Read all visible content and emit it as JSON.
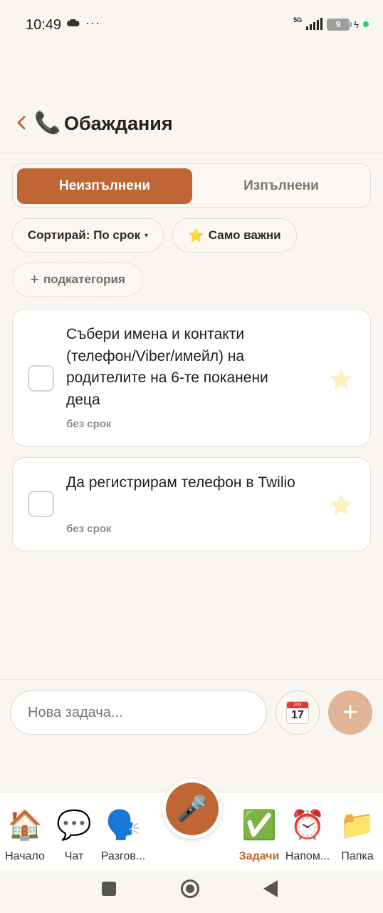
{
  "status_bar": {
    "time": "10:49",
    "dots": "···",
    "network": "5G",
    "battery": "9",
    "icons": [
      "cloud-icon",
      "signal-icon",
      "battery-icon",
      "charging-icon"
    ]
  },
  "header": {
    "back_icon": "chevron-left-icon",
    "emoji": "📞",
    "title": "Обаждания"
  },
  "tabs": [
    {
      "label": "Неизпълнени",
      "active": true
    },
    {
      "label": "Изпълнени",
      "active": false
    }
  ],
  "filters": {
    "sort_label": "Сортирай: По срок",
    "sort_caret": "▾",
    "important_star": "⭐",
    "important_label": "Само важни",
    "subcategory_plus": "+",
    "subcategory_label": "подкатегория"
  },
  "tasks": [
    {
      "text": "Събери имена и контакти (телефон/Viber/имейл) на родителите на 6-те поканени деца",
      "due": "без срок",
      "important": false
    },
    {
      "text": "Да регистрирам телефон в Twilio",
      "due": "без срок",
      "important": false
    }
  ],
  "composer": {
    "placeholder": "Нова задача...",
    "calendar_month": "July",
    "calendar_day": "17",
    "add_symbol": "+"
  },
  "bottom_nav": {
    "mic_emoji": "🎤",
    "items": [
      {
        "emoji": "🏠",
        "label": "Начало"
      },
      {
        "emoji": "💬",
        "label": "Чат"
      },
      {
        "emoji": "🗣️",
        "label": "Разгов..."
      },
      {
        "emoji": "✅",
        "label": "Задачи",
        "active": true
      },
      {
        "emoji": "⏰",
        "label": "Напом..."
      },
      {
        "emoji": "📁",
        "label": "Папка"
      }
    ]
  },
  "colors": {
    "accent": "#c06634",
    "background": "#f9f5f0",
    "add_button": "#dfb497"
  }
}
